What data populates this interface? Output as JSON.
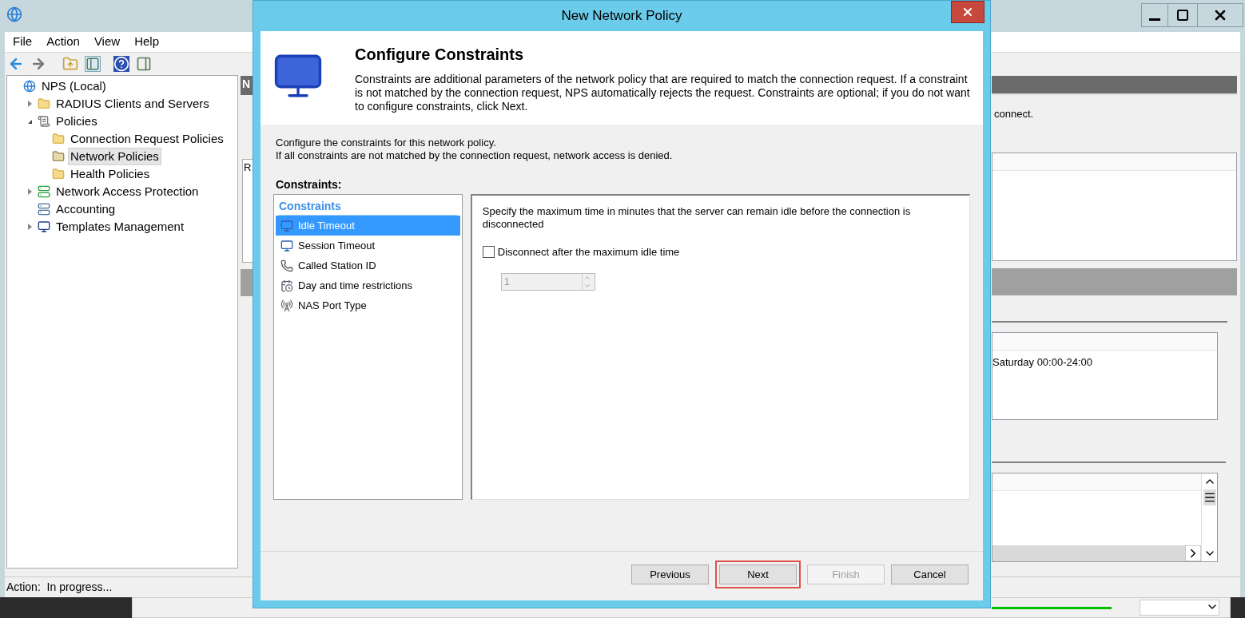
{
  "window": {
    "menu": [
      "File",
      "Action",
      "View",
      "Help"
    ]
  },
  "tree": [
    {
      "label": "NPS (Local)",
      "kind": "globe",
      "selected": false,
      "children": [
        {
          "label": "RADIUS Clients and Servers",
          "kind": "folder",
          "selected": false,
          "expanded": false
        },
        {
          "label": "Policies",
          "kind": "scroll",
          "selected": false,
          "expanded": true,
          "children": [
            {
              "label": "Connection Request Policies",
              "kind": "folder",
              "selected": false
            },
            {
              "label": "Network Policies",
              "kind": "folder-busy",
              "selected": true
            },
            {
              "label": "Health Policies",
              "kind": "folder",
              "selected": false
            }
          ]
        },
        {
          "label": "Network Access Protection",
          "kind": "server-check",
          "selected": false,
          "expanded": false
        },
        {
          "label": "Accounting",
          "kind": "server",
          "selected": false
        },
        {
          "label": "Templates Management",
          "kind": "monitor",
          "selected": false,
          "expanded": false
        }
      ]
    }
  ],
  "middle_pane": {
    "header": "N",
    "column_1": "R"
  },
  "right_pane": {
    "description": "connect.",
    "schedule": "Saturday 00:00-24:00"
  },
  "status_bar": "Action:  In progress...",
  "dialog": {
    "title": "New Network Policy",
    "heading": "Configure Constraints",
    "description": "Constraints are additional parameters of the network policy that are required to match the connection request. If a constraint is not matched by the connection request, NPS automatically rejects the request. Constraints are optional; if you do not want to configure constraints, click Next.",
    "intro": [
      "Configure the constraints for this network policy.",
      "If all constraints are not matched by the connection request, network access is denied."
    ],
    "constraints_label": "Constraints:",
    "list_heading": "Constraints",
    "items": [
      {
        "label": "Idle Timeout",
        "kind": "timeout",
        "selected": true
      },
      {
        "label": "Session Timeout",
        "kind": "timeout",
        "selected": false
      },
      {
        "label": "Called Station ID",
        "kind": "phone",
        "selected": false
      },
      {
        "label": "Day and time restrictions",
        "kind": "calendar",
        "selected": false
      },
      {
        "label": "NAS Port Type",
        "kind": "antenna",
        "selected": false
      }
    ],
    "detail": {
      "description": "Specify the maximum time in minutes that the server can remain idle before the connection is disconnected",
      "checkbox": {
        "label": "Disconnect after the maximum idle time",
        "checked": false
      },
      "spinner": {
        "value": "1",
        "disabled": true
      }
    },
    "buttons": [
      {
        "label": "Previous",
        "disabled": false,
        "highlighted": false
      },
      {
        "label": "Next",
        "disabled": false,
        "highlighted": true
      },
      {
        "label": "Finish",
        "disabled": true,
        "highlighted": false
      },
      {
        "label": "Cancel",
        "disabled": false,
        "highlighted": false
      }
    ]
  }
}
